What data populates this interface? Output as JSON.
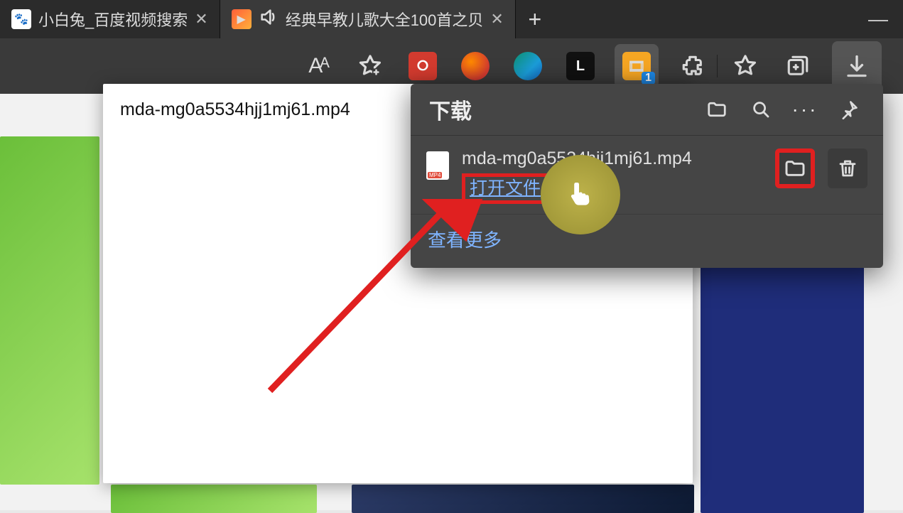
{
  "tabs": [
    {
      "title": "小白兔_百度视频搜索",
      "favicon": "baidu"
    },
    {
      "title": "经典早教儿歌大全100首之贝",
      "favicon": "video",
      "active": true
    }
  ],
  "toolbar": {
    "read_aloud": "Aᴬ",
    "ext_video_badge": "1",
    "ext_black_label": "L"
  },
  "tooltip_filename": "mda-mg0a5534hjj1mj61.mp4",
  "downloads": {
    "panel_title": "下载",
    "item": {
      "filename": "mda-mg0a5534hjj1mj61.mp4",
      "open_label": "打开文件"
    },
    "see_more": "查看更多"
  }
}
